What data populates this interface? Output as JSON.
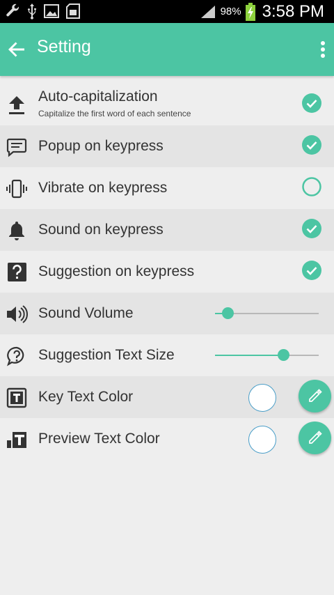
{
  "statusbar": {
    "battery_percent": "98%",
    "time": "3:58 PM"
  },
  "appbar": {
    "title": "Setting"
  },
  "settings": {
    "auto_capitalization": {
      "label": "Auto-capitalization",
      "sublabel": "Capitalize the first word of each sentence",
      "checked": true
    },
    "popup": {
      "label": "Popup on keypress",
      "checked": true
    },
    "vibrate": {
      "label": "Vibrate on keypress",
      "checked": false
    },
    "sound": {
      "label": "Sound on keypress",
      "checked": true
    },
    "suggestion": {
      "label": "Suggestion on keypress",
      "checked": true
    },
    "sound_volume": {
      "label": "Sound Volume",
      "level": 0.12
    },
    "suggestion_text_size": {
      "label": "Suggestion Text Size",
      "level": 0.66
    },
    "key_text_color": {
      "label": "Key Text Color",
      "color": "#ffffff"
    },
    "preview_text_color": {
      "label": "Preview Text Color",
      "color": "#ffffff"
    }
  },
  "colors": {
    "accent": "#4cc5a3",
    "icon": "#333333"
  }
}
